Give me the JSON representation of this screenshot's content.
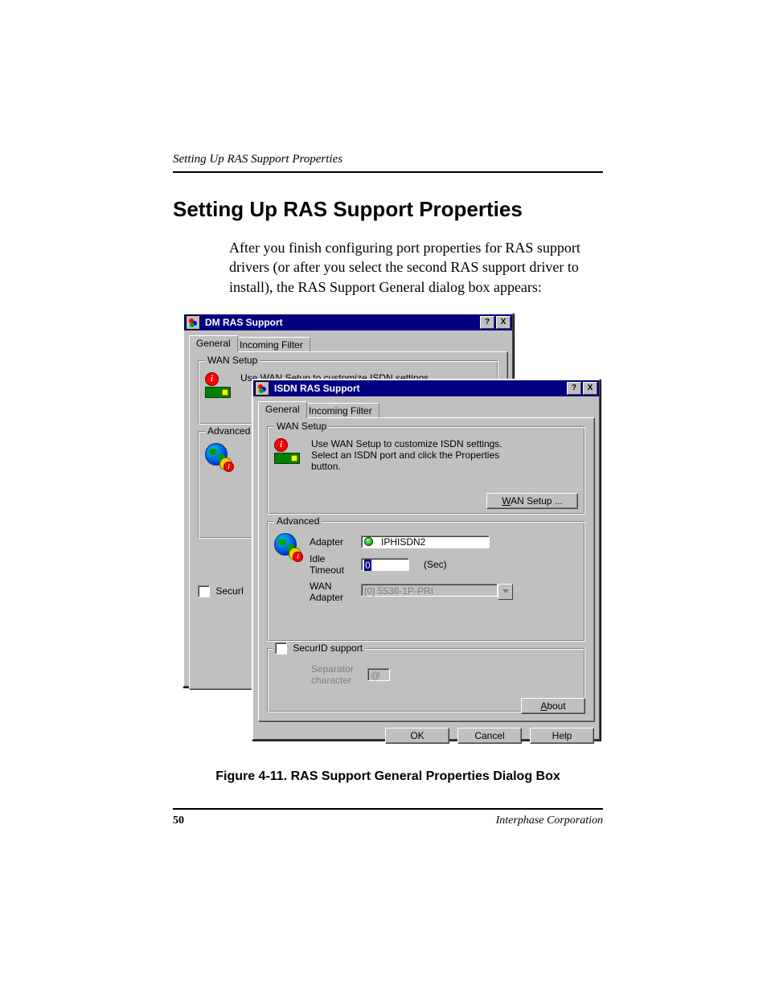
{
  "header": {
    "running_head": "Setting Up RAS Support Properties"
  },
  "section": {
    "title": "Setting Up RAS Support Properties",
    "paragraph": "After you finish configuring port properties for RAS support drivers (or after you select the second RAS support driver to install), the RAS Support General dialog box appears:"
  },
  "dialog_back": {
    "title": "DM RAS Support",
    "tabs": {
      "general": "General",
      "incoming_filter": "Incoming Filter"
    },
    "wan_group": {
      "legend": "WAN Setup",
      "text": "Use WAN Setup to customize ISDN settings."
    },
    "advanced_group": {
      "legend": "Advanced"
    },
    "securid_label_short": "SecurI"
  },
  "dialog_front": {
    "title": "ISDN RAS Support",
    "tabs": {
      "general": "General",
      "incoming_filter": "Incoming Filter"
    },
    "wan_group": {
      "legend": "WAN Setup",
      "text1": "Use WAN Setup to customize ISDN settings.",
      "text2": "Select an ISDN port and click the Properties",
      "text3": "button.",
      "button": "WAN Setup ..."
    },
    "advanced_group": {
      "legend": "Advanced",
      "adapter_label": "Adapter",
      "adapter_value": "IPHISDN2",
      "idle_label1": "Idle",
      "idle_label2": "Timeout",
      "idle_value": "0",
      "idle_unit": "(Sec)",
      "wan_label1": "WAN",
      "wan_label2": "Adapter",
      "wan_adapter_value": "[0] 5536-1P-PRI"
    },
    "securid_group": {
      "label": "SecurID support",
      "separator_label1": "Separator",
      "separator_label2": "character",
      "separator_value": "@"
    },
    "about_button": "About",
    "footer": {
      "ok": "OK",
      "cancel": "Cancel",
      "help": "Help"
    }
  },
  "figure": {
    "caption": "Figure 4-11.  RAS Support General Properties Dialog Box"
  },
  "page_footer": {
    "number": "50",
    "company": "Interphase Corporation"
  },
  "glyphs": {
    "help": "?",
    "close": "X",
    "info": "i"
  }
}
